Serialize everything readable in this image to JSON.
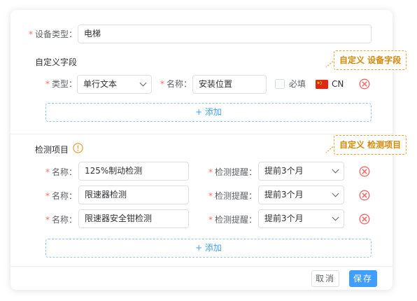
{
  "device_type": {
    "required_mark": "*",
    "label": "设备类型：",
    "value": "电梯"
  },
  "custom_fields": {
    "title": "自定义字段",
    "callout": "自定义 设备字段",
    "row": {
      "type_label": "类型：",
      "type_value": "单行文本",
      "name_label": "名称：",
      "name_value": "安装位置",
      "required_label": "必填",
      "lang_code": "CN"
    },
    "add_label": "+ 添加"
  },
  "inspection": {
    "title": "检测项目",
    "callout": "自定义 检测项目",
    "items": [
      {
        "name_label": "名称：",
        "name_value": "125%制动检测",
        "remind_label": "检测提醒：",
        "remind_value": "提前3个月"
      },
      {
        "name_label": "名称：",
        "name_value": "限速器检测",
        "remind_label": "检测提醒：",
        "remind_value": "提前3个月"
      },
      {
        "name_label": "名称：",
        "name_value": "限速器安全钳检测",
        "remind_label": "检测提醒：",
        "remind_value": "提前3个月"
      }
    ],
    "add_label": "+ 添加"
  },
  "footer": {
    "cancel_label": "取消",
    "save_label": "保存"
  },
  "colors": {
    "primary": "#409eff",
    "danger": "#f56c6c",
    "warning": "#e6a23c"
  }
}
